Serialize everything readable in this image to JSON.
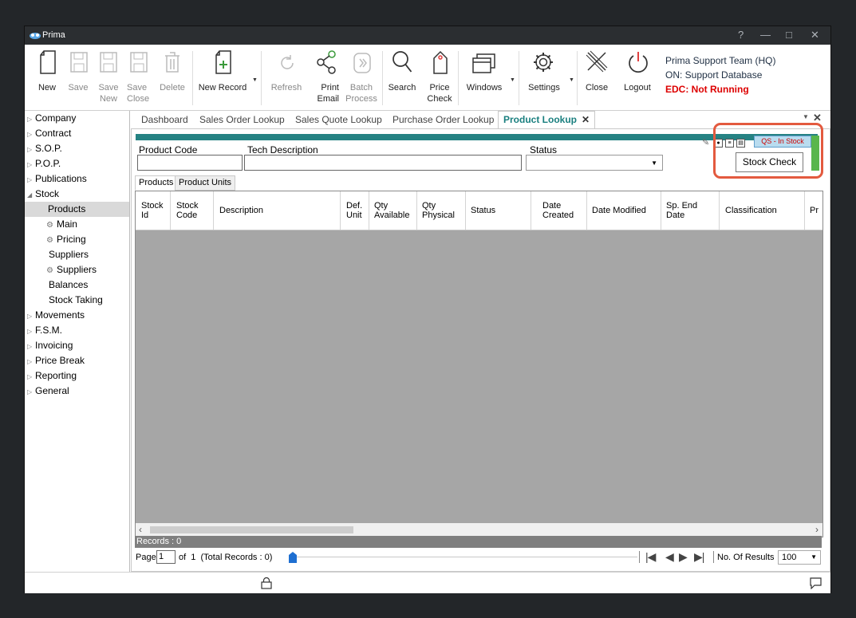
{
  "window": {
    "title": "Prima",
    "controls": [
      "?",
      "—",
      "□",
      "✕"
    ]
  },
  "ribbon": {
    "buttons": [
      {
        "label": "New",
        "icon": "new-file-icon",
        "enabled": true
      },
      {
        "label": "Save",
        "icon": "save-icon",
        "enabled": false
      },
      {
        "label": "Save\nNew",
        "icon": "save-new-icon",
        "enabled": false
      },
      {
        "label": "Save\nClose",
        "icon": "save-close-icon",
        "enabled": false
      },
      {
        "label": "Delete",
        "icon": "delete-icon",
        "enabled": false
      },
      {
        "label": "New Record",
        "icon": "new-record-icon",
        "enabled": true,
        "dropdown": true
      },
      {
        "label": "Refresh",
        "icon": "refresh-icon",
        "enabled": false
      },
      {
        "label": "Print\nEmail",
        "icon": "share-icon",
        "enabled": true
      },
      {
        "label": "Batch\nProcess",
        "icon": "batch-process-icon",
        "enabled": false
      },
      {
        "label": "Search",
        "icon": "search-icon",
        "enabled": true
      },
      {
        "label": "Price\nCheck",
        "icon": "price-tag-icon",
        "enabled": true
      },
      {
        "label": "Windows",
        "icon": "windows-icon",
        "enabled": true,
        "dropdown": true
      },
      {
        "label": "Settings",
        "icon": "gear-icon",
        "enabled": true,
        "dropdown": true
      },
      {
        "label": "Close",
        "icon": "close-x-icon",
        "enabled": true
      },
      {
        "label": "Logout",
        "icon": "power-icon",
        "enabled": true
      }
    ],
    "team": "Prima Support Team (HQ)",
    "database": "ON: Support Database",
    "edc": "EDC: Not Running"
  },
  "sidebar": {
    "items": [
      {
        "label": "Company",
        "level": 0,
        "arrow": "▷"
      },
      {
        "label": "Contract",
        "level": 0,
        "arrow": "▷"
      },
      {
        "label": "S.O.P.",
        "level": 0,
        "arrow": "▷"
      },
      {
        "label": "P.O.P.",
        "level": 0,
        "arrow": "▷"
      },
      {
        "label": "Publications",
        "level": 0,
        "arrow": "▷"
      },
      {
        "label": "Stock",
        "level": 0,
        "arrow": "◢"
      },
      {
        "label": "Products",
        "level": 1,
        "selected": true
      },
      {
        "label": "Main",
        "level": 2,
        "gear": true
      },
      {
        "label": "Pricing",
        "level": 2,
        "gear": true
      },
      {
        "label": "Suppliers",
        "level": 1
      },
      {
        "label": "Suppliers",
        "level": 2,
        "gear": true
      },
      {
        "label": "Balances",
        "level": 1
      },
      {
        "label": "Stock Taking",
        "level": 1
      },
      {
        "label": "Movements",
        "level": 0,
        "arrow": "▷"
      },
      {
        "label": "F.S.M.",
        "level": 0,
        "arrow": "▷"
      },
      {
        "label": "Invoicing",
        "level": 0,
        "arrow": "▷"
      },
      {
        "label": "Price Break",
        "level": 0,
        "arrow": "▷"
      },
      {
        "label": "Reporting",
        "level": 0,
        "arrow": "▷"
      },
      {
        "label": "General",
        "level": 0,
        "arrow": "▷"
      }
    ]
  },
  "tabs": [
    {
      "label": "Dashboard"
    },
    {
      "label": "Sales Order Lookup"
    },
    {
      "label": "Sales Quote Lookup"
    },
    {
      "label": "Purchase Order Lookup"
    },
    {
      "label": "Product Lookup",
      "active": true
    }
  ],
  "filters": {
    "product_code": {
      "label": "Product Code",
      "value": ""
    },
    "tech_description": {
      "label": "Tech Description",
      "value": ""
    },
    "status": {
      "label": "Status",
      "value": ""
    }
  },
  "qs_button": "QS - In Stock",
  "stock_check": "Stock Check",
  "subtabs": [
    {
      "label": "Products",
      "active": true
    },
    {
      "label": "Product Units"
    }
  ],
  "grid": {
    "columns": [
      "Stock\nId",
      "Stock\nCode",
      "Description",
      "Def.\nUnit",
      "Qty\nAvailable",
      "Qty\nPhysical",
      "Status",
      "Date\nCreated",
      "Date Modified",
      "Sp. End\nDate",
      "Classification",
      "Pr"
    ],
    "rows": []
  },
  "status_bar": {
    "records": "Records : 0"
  },
  "pager": {
    "page_label": "Page",
    "page_value": "1",
    "of_text": "of  1  (Total Records : 0)",
    "results_label": "No. Of Results",
    "results_value": "100"
  }
}
